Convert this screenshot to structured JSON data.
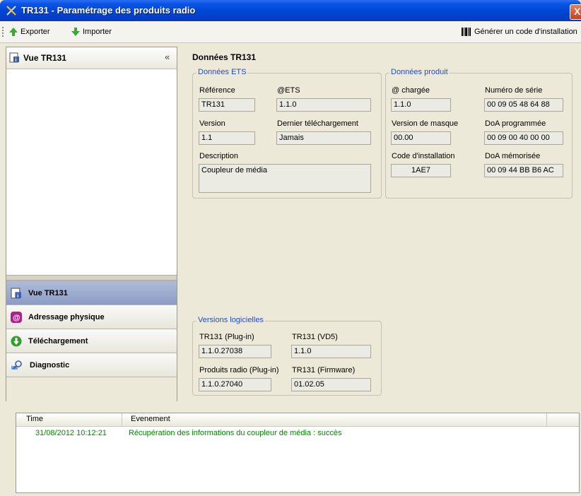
{
  "window": {
    "title": "TR131 - Paramétrage des produits radio",
    "close_glyph": "X"
  },
  "toolbar": {
    "export_label": "Exporter",
    "import_label": "Importer",
    "generate_label": "Générer un code d'installation"
  },
  "left_panel": {
    "header": "Vue TR131",
    "collapse_glyph": "«",
    "nav": [
      {
        "label": "Vue TR131",
        "icon": "info-doc-icon",
        "selected": true
      },
      {
        "label": "Adressage physique",
        "icon": "at-icon"
      },
      {
        "label": "Téléchargement",
        "icon": "download-icon"
      },
      {
        "label": "Diagnostic",
        "icon": "magnifier-icon"
      }
    ]
  },
  "content": {
    "title": "Données TR131",
    "ets": {
      "legend": "Données ETS",
      "reference_label": "Référence",
      "reference_value": "TR131",
      "ets_label": "@ETS",
      "ets_value": "1.1.0",
      "version_label": "Version",
      "version_value": "1.1",
      "last_dl_label": "Dernier téléchargement",
      "last_dl_value": "Jamais",
      "description_label": "Description",
      "description_value": "Coupleur de média"
    },
    "product": {
      "legend": "Données produit",
      "loaded_label": "@ chargée",
      "loaded_value": "1.1.0",
      "serial_label": "Numéro de série",
      "serial_value": "00 09 05 48 64 88",
      "mask_label": "Version de masque",
      "mask_value": "00.00",
      "doa_prog_label": "DoA programmée",
      "doa_prog_value": "00 09 00 40 00 00",
      "install_label": "Code d'installation",
      "install_value": "1AE7",
      "doa_mem_label": "DoA mémorisée",
      "doa_mem_value": "00 09 44 BB B6 AC"
    },
    "versions": {
      "legend": "Versions logicielles",
      "plugin_label": "TR131 (Plug-in)",
      "plugin_value": "1.1.0.27038",
      "vd5_label": "TR131 (VD5)",
      "vd5_value": "1.1.0",
      "radio_label": "Produits radio (Plug-in)",
      "radio_value": "1.1.0.27040",
      "firmware_label": "TR131 (Firmware)",
      "firmware_value": "01.02.05"
    }
  },
  "log": {
    "col_time": "Time",
    "col_event": "Evenement",
    "rows": [
      {
        "time": "31/08/2012 10:12:21",
        "event": "Récupération des informations du coupleur de média : succès"
      }
    ]
  },
  "colors": {
    "title_bar": "#0a55e6",
    "legend_blue": "#1a4fcf",
    "log_green": "#008a00",
    "selected_nav": "#9dadd1"
  }
}
